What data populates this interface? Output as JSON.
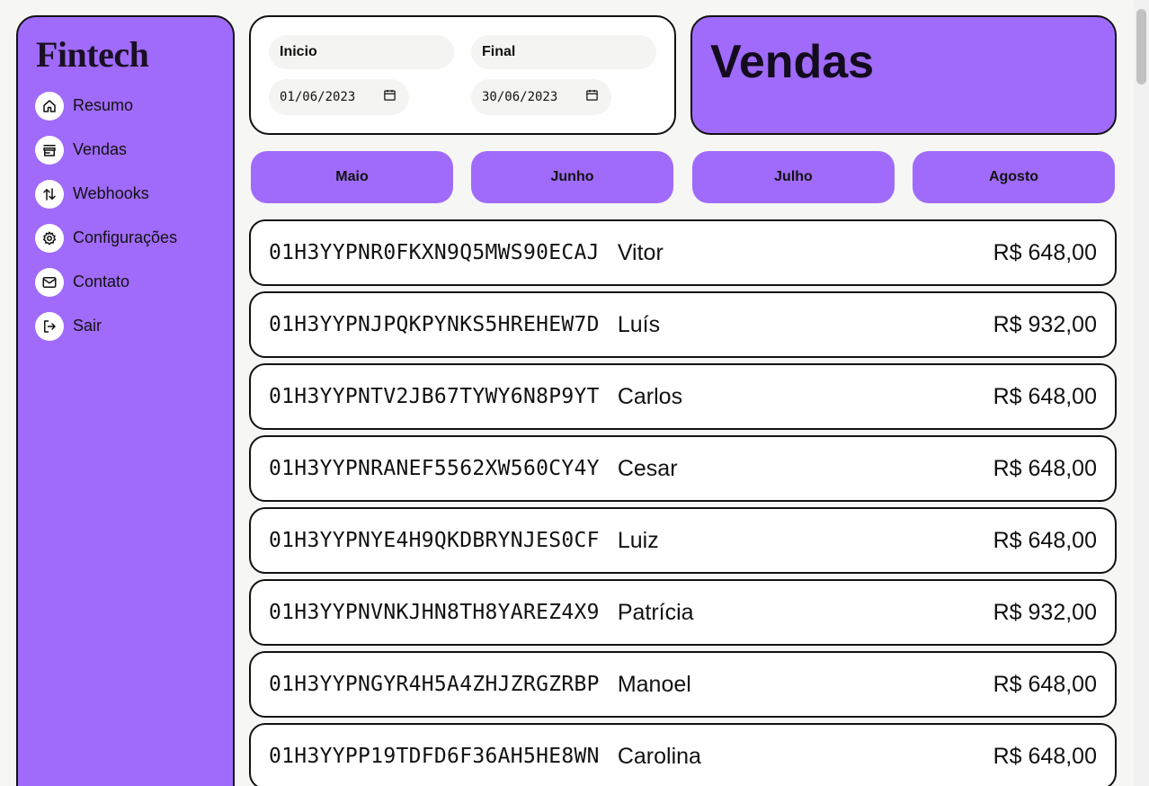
{
  "logo": "Fintech",
  "nav": [
    {
      "label": "Resumo",
      "icon": "home-icon"
    },
    {
      "label": "Vendas",
      "icon": "store-icon"
    },
    {
      "label": "Webhooks",
      "icon": "arrows-updown-icon"
    },
    {
      "label": "Configurações",
      "icon": "gear-icon"
    },
    {
      "label": "Contato",
      "icon": "mail-icon"
    },
    {
      "label": "Sair",
      "icon": "logout-icon"
    }
  ],
  "dates": {
    "start_label": "Inicio",
    "start_value": "01/06/2023",
    "end_label": "Final",
    "end_value": "30/06/2023"
  },
  "page_title": "Vendas",
  "months": [
    "Maio",
    "Junho",
    "Julho",
    "Agosto"
  ],
  "sales": [
    {
      "id": "01H3YYPNR0FKXN9Q5MWS90ECAJ",
      "name": "Vitor",
      "value": "R$ 648,00"
    },
    {
      "id": "01H3YYPNJPQKPYNKS5HREHEW7D",
      "name": "Luís",
      "value": "R$ 932,00"
    },
    {
      "id": "01H3YYPNTV2JB67TYWY6N8P9YT",
      "name": "Carlos",
      "value": "R$ 648,00"
    },
    {
      "id": "01H3YYPNRANEF5562XW560CY4Y",
      "name": "Cesar",
      "value": "R$ 648,00"
    },
    {
      "id": "01H3YYPNYE4H9QKDBRYNJES0CF",
      "name": "Luiz",
      "value": "R$ 648,00"
    },
    {
      "id": "01H3YYPNVNKJHN8TH8YAREZ4X9",
      "name": "Patrícia",
      "value": "R$ 932,00"
    },
    {
      "id": "01H3YYPNGYR4H5A4ZHJZRGZRBP",
      "name": "Manoel",
      "value": "R$ 648,00"
    },
    {
      "id": "01H3YYPP19TDFD6F36AH5HE8WN",
      "name": "Carolina",
      "value": "R$ 648,00"
    }
  ],
  "colors": {
    "accent": "#a06bfa",
    "border": "#111111",
    "background": "#f6f6f4"
  }
}
